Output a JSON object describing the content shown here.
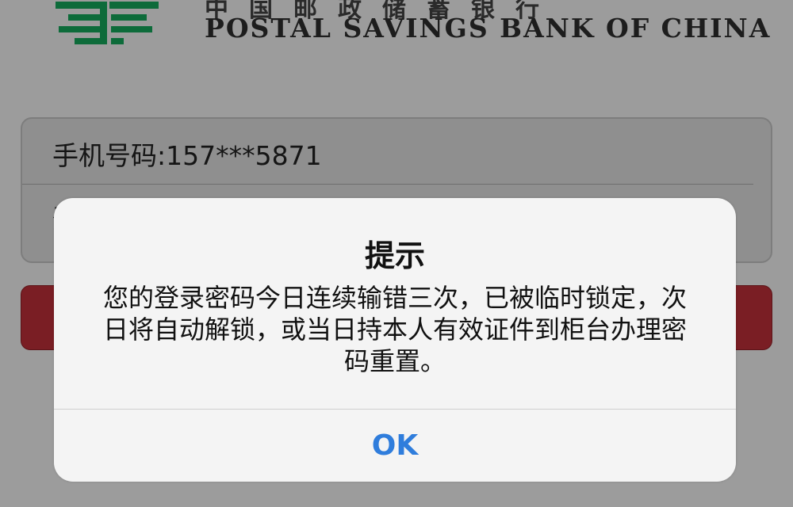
{
  "header": {
    "bank_name_cn": "中国邮政储蓄银行",
    "bank_name_en": "POSTAL SAVINGS BANK OF CHINA"
  },
  "login_form": {
    "phone_label": "手机号码:",
    "phone_value": "157***5871",
    "password_label": "登"
  },
  "alert": {
    "title": "提示",
    "message": "您的登录密码今日连续输错三次，已被临时锁定，次日将自动解锁，或当日持本人有效证件到柜台办理密码重置。",
    "ok_label": "OK"
  },
  "colors": {
    "brand_green": "#0d6b3a",
    "login_button": "#7a1e24",
    "ok_text": "#2f7ddc"
  },
  "icons": [
    "postal-logo-icon"
  ]
}
